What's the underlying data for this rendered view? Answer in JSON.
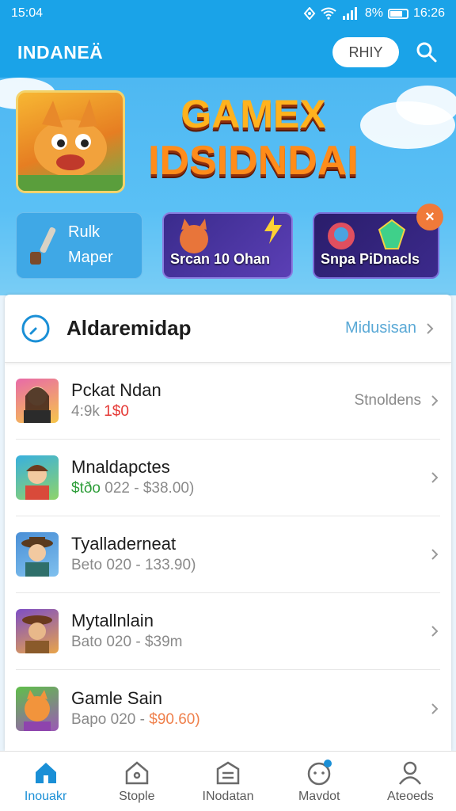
{
  "status": {
    "time": "15:04",
    "battery_text": "8%",
    "clock_right": "16:26"
  },
  "appbar": {
    "title": "INDANEÄ",
    "play_label": "RHIY"
  },
  "banner": {
    "title_line1": "GAMEX",
    "title_line2": "IDSIDNDAI",
    "card1_line1": "Rulk",
    "card1_line2": "Maper",
    "card2_text": "Srcan 10 Ohan",
    "card3_text": "Snpa PiDnacls",
    "close_label": "×"
  },
  "section": {
    "title": "Aldaremidap",
    "more_label": "Midusisan"
  },
  "rows": [
    {
      "title": "Pckat Ndan",
      "sub_prefix": "4:9k ",
      "sub_accent": "1$0",
      "right": "Stnoldens"
    },
    {
      "title": "Mnaldapctes",
      "sub_prefix": "",
      "sub_accent": "$tðo",
      "sub_suffix": " 022 - $38.00)",
      "right": ""
    },
    {
      "title": "Tyalladerneat",
      "sub_prefix": "Beto 020 - 133.90)",
      "right": ""
    },
    {
      "title": "Mytallnlain",
      "sub_prefix": "Bato 020 - $39m",
      "right": ""
    },
    {
      "title": "Gamle Sain",
      "sub_prefix": "Bapo 020 - ",
      "sub_accent": "$90.60)",
      "right": ""
    }
  ],
  "nav": [
    {
      "label": "Inouakr"
    },
    {
      "label": "Stople"
    },
    {
      "label": "INodatan"
    },
    {
      "label": "Mavdot"
    },
    {
      "label": "Ateoeds"
    }
  ],
  "colors": {
    "primary": "#1aa3e8",
    "accent": "#5aa9d6",
    "active_nav": "#1a8fd6"
  }
}
